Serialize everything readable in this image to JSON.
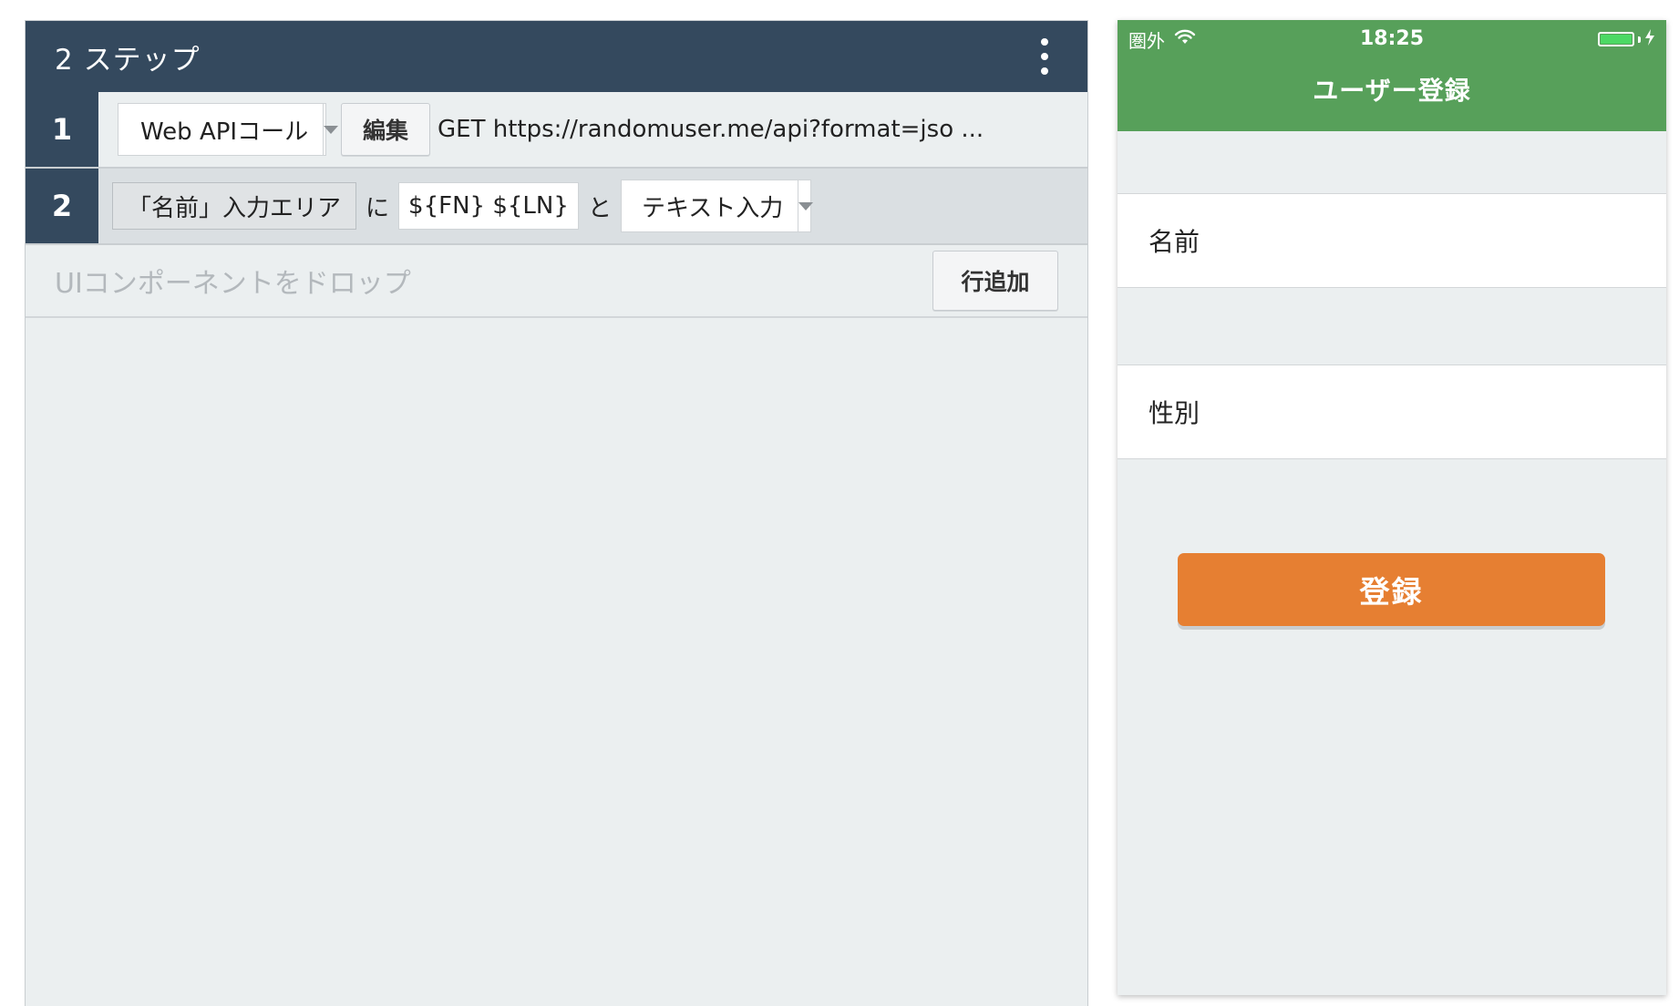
{
  "editor": {
    "title": "2 ステップ",
    "steps": [
      {
        "number": "1",
        "action": "Web APIコール",
        "edit_label": "編集",
        "summary": "GET https://randomuser.me/api?format=jso ..."
      },
      {
        "number": "2",
        "target": "「名前」入力エリア",
        "particle_ni": "に",
        "value": "${FN} ${LN}",
        "particle_to": "と",
        "action": "テキスト入力"
      }
    ],
    "drop_placeholder": "UIコンポーネントをドロップ",
    "add_row_label": "行追加"
  },
  "phone": {
    "carrier": "圏外",
    "time": "18:25",
    "nav_title": "ユーザー登録",
    "fields": [
      {
        "label": "名前"
      },
      {
        "label": "性別"
      }
    ],
    "submit_label": "登録",
    "colors": {
      "nav_bar": "#57a05a",
      "submit": "#e67f32",
      "battery": "#4cd964"
    }
  },
  "colors": {
    "editor_header": "#34495e",
    "editor_bg": "#ebeff0"
  },
  "icons": [
    "more-vertical-icon",
    "dropdown-arrow-icon",
    "wifi-icon",
    "battery-icon",
    "charging-bolt-icon"
  ]
}
